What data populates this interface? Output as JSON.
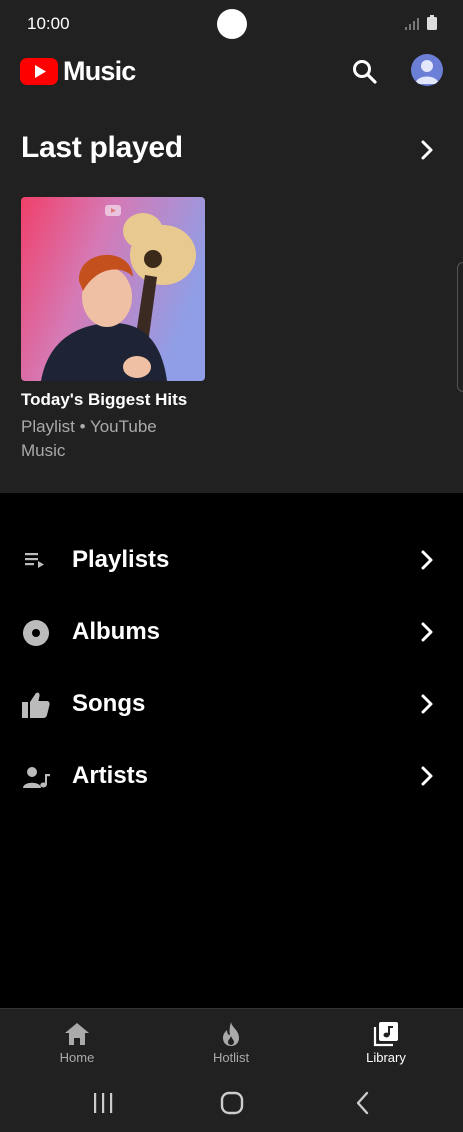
{
  "status_bar": {
    "time": "10:00"
  },
  "header": {
    "app_name": "Music",
    "brand_color": "#ff0000",
    "search_icon": "search-icon",
    "account_icon": "avatar-icon"
  },
  "last_played": {
    "title": "Last played",
    "item": {
      "title": "Today's Biggest Hits",
      "subtitle": "Playlist • YouTube Music"
    }
  },
  "library": {
    "items": [
      {
        "label": "Playlists",
        "icon": "playlist-icon"
      },
      {
        "label": "Albums",
        "icon": "album-icon"
      },
      {
        "label": "Songs",
        "icon": "thumbs-up-icon"
      },
      {
        "label": "Artists",
        "icon": "artist-icon"
      }
    ]
  },
  "bottom_nav": {
    "items": [
      {
        "label": "Home",
        "icon": "home-icon",
        "active": false
      },
      {
        "label": "Hotlist",
        "icon": "flame-icon",
        "active": false
      },
      {
        "label": "Library",
        "icon": "library-icon",
        "active": true
      }
    ]
  }
}
